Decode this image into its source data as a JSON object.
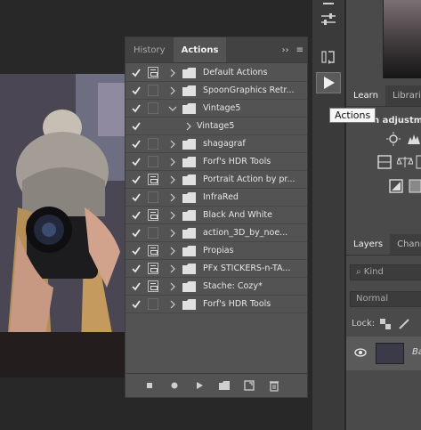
{
  "actions_panel": {
    "tabs": [
      {
        "label": "History"
      },
      {
        "label": "Actions"
      }
    ],
    "expand_label": "›› ",
    "menu_label": "≡",
    "rows": [
      {
        "label": "Default Actions",
        "dialog": true,
        "expanded": false,
        "indent": 0
      },
      {
        "label": "SpoonGraphics Retr...",
        "dialog": false,
        "expanded": false,
        "indent": 0
      },
      {
        "label": "Vintage5",
        "dialog": false,
        "expanded": true,
        "indent": 0
      },
      {
        "label": "Vintage5",
        "dialog": false,
        "expanded": false,
        "indent": 1
      },
      {
        "label": "shagagraf",
        "dialog": false,
        "expanded": false,
        "indent": 0
      },
      {
        "label": "Forf's HDR Tools",
        "dialog": false,
        "expanded": false,
        "indent": 0
      },
      {
        "label": "Portrait Action by pr...",
        "dialog": true,
        "expanded": false,
        "indent": 0
      },
      {
        "label": "InfraRed",
        "dialog": false,
        "expanded": false,
        "indent": 0
      },
      {
        "label": "Black And White",
        "dialog": true,
        "expanded": false,
        "indent": 0
      },
      {
        "label": "action_3D_by_noe...",
        "dialog": false,
        "expanded": false,
        "indent": 0
      },
      {
        "label": "Propias",
        "dialog": true,
        "expanded": false,
        "indent": 0
      },
      {
        "label": "PFx STICKERS-n-TA...",
        "dialog": true,
        "expanded": false,
        "indent": 0
      },
      {
        "label": "Stache: Cozy*",
        "dialog": true,
        "expanded": false,
        "indent": 0
      },
      {
        "label": "Forf's HDR Tools",
        "dialog": false,
        "expanded": false,
        "indent": 0
      }
    ]
  },
  "right_panels": {
    "learn_tabs": [
      "Learn",
      "Librari"
    ],
    "adjust_label": "n adjustm",
    "layers_tabs": [
      "Layers",
      "Chann"
    ],
    "kind_placeholder": "Kind",
    "blend_mode": "Normal",
    "lock_label": "Lock:",
    "layer_name": "Ba"
  },
  "tooltip": {
    "text": "Actions"
  },
  "colors": {
    "panel_bg": "#535353",
    "app_bg": "#282828",
    "accent": "#f0f0f0"
  }
}
